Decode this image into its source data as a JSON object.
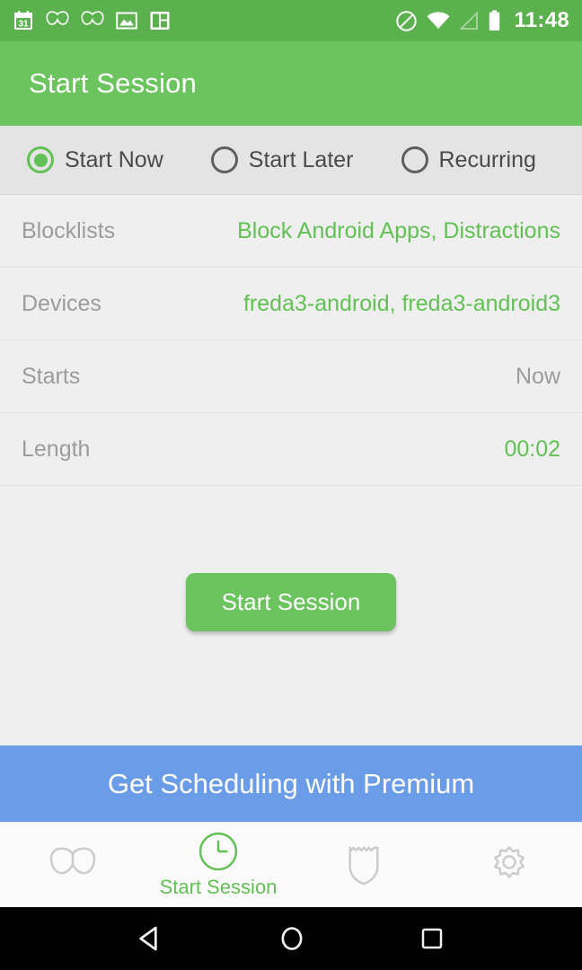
{
  "status_bar": {
    "time": "11:48",
    "left_icons": [
      "calendar-icon",
      "butterfly-icon",
      "butterfly-icon",
      "photo-icon",
      "panel-icon"
    ],
    "calendar_day": "31",
    "right_icons": [
      "do-not-disturb-icon",
      "wifi-icon",
      "cell-signal-icon",
      "battery-icon"
    ],
    "colors": {
      "background": "#5cb14f",
      "foreground": "#ffffff"
    }
  },
  "app_bar": {
    "title": "Start Session",
    "background": "#6cc45f",
    "text_color": "#ffffff"
  },
  "mode_selector": {
    "options": [
      {
        "label": "Start Now",
        "selected": true
      },
      {
        "label": "Start Later",
        "selected": false
      },
      {
        "label": "Recurring",
        "selected": false
      }
    ],
    "selected_color": "#62c154",
    "unselected_color": "#5f5f5f",
    "background": "#e4e4e4"
  },
  "details": {
    "rows": [
      {
        "label": "Blocklists",
        "value": "Block Android Apps, Distractions",
        "value_style": "green"
      },
      {
        "label": "Devices",
        "value": "freda3-android, freda3-android3",
        "value_style": "green"
      },
      {
        "label": "Starts",
        "value": "Now",
        "value_style": "grey"
      },
      {
        "label": "Length",
        "value": "00:02",
        "value_style": "green"
      }
    ],
    "label_color": "#9c9c9c",
    "green_value_color": "#62c154",
    "background": "#efefef"
  },
  "primary_action": {
    "label": "Start Session",
    "background": "#6cc45f",
    "text_color": "#ffffff"
  },
  "premium_banner": {
    "label": "Get Scheduling with Premium",
    "background": "#6b9ce8",
    "text_color": "#ffffff"
  },
  "bottom_tabs": {
    "items": [
      {
        "icon": "butterfly-icon",
        "label": "",
        "active": false
      },
      {
        "icon": "clock-icon",
        "label": "Start Session",
        "active": true
      },
      {
        "icon": "shield-icon",
        "label": "",
        "active": false
      },
      {
        "icon": "gear-icon",
        "label": "",
        "active": false
      }
    ],
    "active_color": "#62c154",
    "inactive_color": "#cccccc",
    "background": "#fbfbfb"
  },
  "android_nav": {
    "buttons": [
      "back-icon",
      "home-icon",
      "recents-icon"
    ],
    "background": "#000000",
    "icon_color": "#ffffff"
  }
}
